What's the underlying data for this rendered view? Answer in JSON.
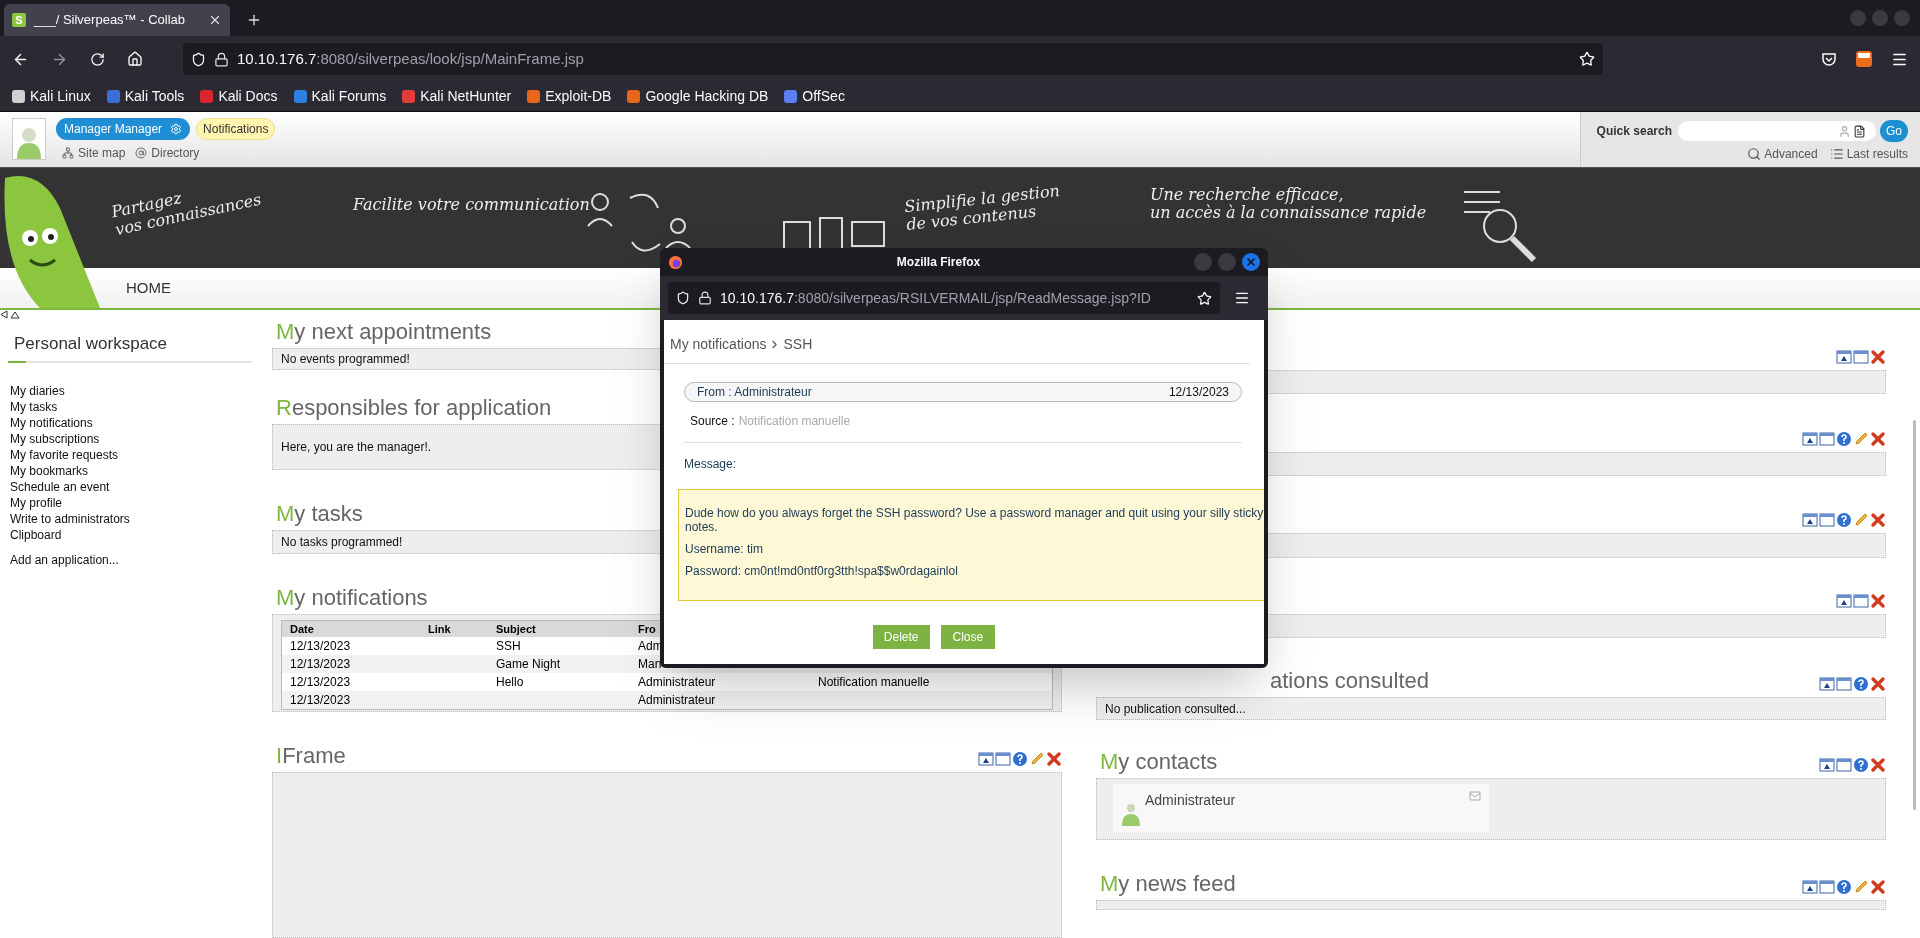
{
  "browser": {
    "tab": {
      "favicon_letter": "S",
      "title": "___/ Silverpeas™ - Collab"
    },
    "url": {
      "host": "10.10.176.7",
      "path": ":8080/silverpeas/look/jsp/MainFrame.jsp"
    },
    "bookmarks": [
      {
        "label": "Kali Linux",
        "color": "#d0d0d0"
      },
      {
        "label": "Kali Tools",
        "color": "#3b6fd8"
      },
      {
        "label": "Kali Docs",
        "color": "#d8262f"
      },
      {
        "label": "Kali Forums",
        "color": "#2f7fe0"
      },
      {
        "label": "Kali NetHunter",
        "color": "#e23b3b"
      },
      {
        "label": "Exploit-DB",
        "color": "#e8661c"
      },
      {
        "label": "Google Hacking DB",
        "color": "#e8661c"
      },
      {
        "label": "OffSec",
        "color": "#5a7ff0"
      }
    ]
  },
  "header": {
    "user_button": "Manager Manager",
    "notifications": "Notifications",
    "links": [
      {
        "label": "Site map",
        "kind": "sitemap"
      },
      {
        "label": "Directory",
        "kind": "directory"
      }
    ],
    "quick_search": {
      "label": "Quick search",
      "button": "Go",
      "links": [
        {
          "label": "Advanced",
          "kind": "advanced"
        },
        {
          "label": "Last results",
          "kind": "results"
        }
      ]
    }
  },
  "banner": {
    "taglines": [
      "Partagez\nvos connaissances",
      "Facilite votre communication",
      "Simplifie la gestion\nde vos contenus",
      "Une recherche efficace,\nun accès à la connaissance rapide"
    ]
  },
  "menu": {
    "items": [
      "HOME"
    ]
  },
  "sidebar": {
    "title": "Personal workspace",
    "links": [
      "My diaries",
      "My tasks",
      "My notifications",
      "My subscriptions",
      "My favorite requests",
      "My bookmarks",
      "Schedule an event",
      "My profile",
      "Write to administrators",
      "Clipboard"
    ],
    "extra_link": "Add an application..."
  },
  "middle_column": [
    {
      "kind": "message",
      "title": "My next appointments",
      "text": "No events programmed!"
    },
    {
      "kind": "message",
      "title": "Responsibles for application",
      "text": "Here, you are the manager!."
    },
    {
      "kind": "message",
      "title": "My tasks",
      "text": "No tasks programmed!"
    },
    {
      "kind": "table",
      "title": "My notifications",
      "columns": {
        "date": "Date",
        "link": "Link",
        "subject": "Subject",
        "from": "Fro"
      },
      "rows": [
        {
          "date": "12/13/2023",
          "subject": "SSH",
          "from": "Adm"
        },
        {
          "date": "12/13/2023",
          "subject": "Game Night",
          "from": "Man"
        },
        {
          "date": "12/13/2023",
          "subject": "Hello",
          "from": "Administrateur",
          "column_5": "Notification manuelle"
        },
        {
          "date": "12/13/2023",
          "from": "Administrateur"
        }
      ]
    },
    {
      "kind": "frame",
      "title": "IFrame",
      "tools": [
        {
          "kind": "minimize"
        },
        {
          "kind": "maximize"
        },
        {
          "kind": "help"
        },
        {
          "kind": "edit"
        },
        {
          "kind": "close"
        }
      ]
    }
  ],
  "right_column": [
    {
      "kind": "empty",
      "tools": [
        {
          "kind": "minimize"
        },
        {
          "kind": "maximize"
        },
        {
          "kind": "close"
        }
      ]
    },
    {
      "kind": "empty",
      "tools": [
        {
          "kind": "minimize"
        },
        {
          "kind": "maximize"
        },
        {
          "kind": "help"
        },
        {
          "kind": "edit"
        },
        {
          "kind": "close"
        }
      ]
    },
    {
      "kind": "empty",
      "tools": [
        {
          "kind": "minimize"
        },
        {
          "kind": "maximize"
        },
        {
          "kind": "help"
        },
        {
          "kind": "edit"
        },
        {
          "kind": "close"
        }
      ]
    },
    {
      "kind": "empty",
      "tools": [
        {
          "kind": "minimize"
        },
        {
          "kind": "maximize"
        },
        {
          "kind": "close"
        }
      ]
    },
    {
      "kind": "message",
      "title_fragment": "ations consulted",
      "text": "No publication consulted...",
      "tools": [
        {
          "kind": "minimize"
        },
        {
          "kind": "maximize"
        },
        {
          "kind": "help"
        },
        {
          "kind": "close"
        }
      ]
    },
    {
      "kind": "contacts",
      "title": "My contacts",
      "contacts": [
        {
          "name": "Administrateur"
        }
      ],
      "tools": [
        {
          "kind": "minimize"
        },
        {
          "kind": "maximize"
        },
        {
          "kind": "help"
        },
        {
          "kind": "close"
        }
      ]
    },
    {
      "kind": "empty",
      "title": "My news feed",
      "tools": [
        {
          "kind": "minimize"
        },
        {
          "kind": "maximize"
        },
        {
          "kind": "help"
        },
        {
          "kind": "edit"
        },
        {
          "kind": "close"
        }
      ]
    }
  ],
  "popup": {
    "title": "Mozilla Firefox",
    "url": {
      "host": "10.10.176.7",
      "path": ":8080/silverpeas/RSILVERMAIL/jsp/ReadMessage.jsp?ID"
    },
    "breadcrumb": [
      "My notifications",
      "SSH"
    ],
    "from": "From : Administrateur",
    "date": "12/13/2023",
    "source_label": "Source :",
    "source": "Notification manuelle",
    "message_label": "Message:",
    "message": [
      "Dude how do you always forget the SSH password? Use a password manager and quit using your silly sticky notes.",
      "Username: tim",
      "Password: cm0nt!md0ntf0rg3tth!spa$$w0rdagainlol"
    ],
    "buttons": [
      "Delete",
      "Close"
    ]
  }
}
